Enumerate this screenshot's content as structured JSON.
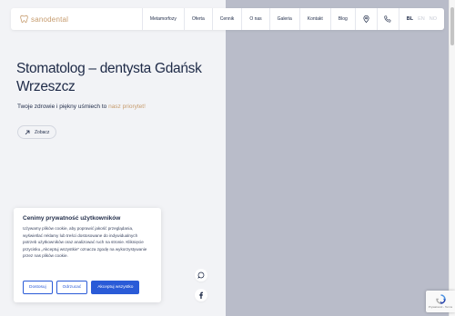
{
  "brand": {
    "name": "sanodental"
  },
  "nav": {
    "items": [
      "Metamorfozy",
      "Oferta",
      "Cennik",
      "O nas",
      "Galeria",
      "Kontakt",
      "Blog"
    ],
    "languages": [
      "BL",
      "EN",
      "NO"
    ],
    "active_language": "BL"
  },
  "hero": {
    "title": "Stomatolog – dentysta Gdańsk Wrzeszcz",
    "subtitle_main": "Twoje zdrowie i piękny uśmiech to ",
    "subtitle_accent": "nasz priorytet!",
    "button_label": "Zobacz"
  },
  "cookie": {
    "title": "Cenimy prywatność użytkowników",
    "text": "Używamy plików cookie, aby poprawić jakość przeglądania, wyświetlać reklamy lub treści dostosowane do indywidualnych potrzeb użytkowników oraz analizować ruch na stronie. Kliknięcie przycisku „Akceptuj wszystkie” oznacza zgodę na wykorzystywanie przez nas plików cookie.",
    "buttons": {
      "customize": "Dostosuj",
      "reject": "Odrzucać",
      "accept": "Akceptuj wszystko"
    }
  },
  "recaptcha": {
    "text": "Prywatność - Terms"
  },
  "colors": {
    "accent": "#c69b6d",
    "text": "#1e2a47",
    "cookie_button": "#2a5bd7",
    "hero_bg": "#b9bcc9",
    "page_bg": "#f2f3f6"
  },
  "icons": [
    "tooth-logo-icon",
    "location-pin-icon",
    "phone-icon",
    "arrow-up-right-icon",
    "chat-icon",
    "facebook-icon",
    "recaptcha-icon"
  ]
}
